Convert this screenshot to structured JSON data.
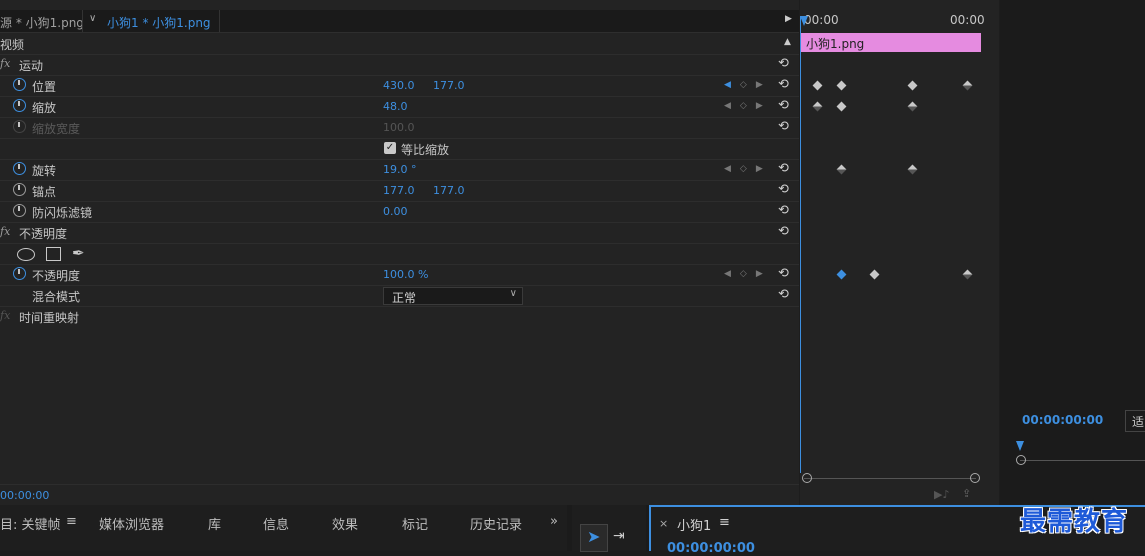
{
  "tabs": {
    "source": "源 * 小狗1.png",
    "active": "小狗1 * 小狗1.png"
  },
  "timeline": {
    "start": "00:00",
    "end": "00:00",
    "clip": "小狗1.png",
    "clip_color": "#e58be0"
  },
  "section": "视频",
  "motion": {
    "title": "运动",
    "position": {
      "label": "位置",
      "x": "430.0",
      "y": "177.0"
    },
    "scale": {
      "label": "缩放",
      "value": "48.0"
    },
    "scale_width": {
      "label": "缩放宽度",
      "value": "100.0"
    },
    "uniform": {
      "label": "等比缩放",
      "checked": true
    },
    "rotation": {
      "label": "旋转",
      "value": "19.0 °"
    },
    "anchor": {
      "label": "锚点",
      "x": "177.0",
      "y": "177.0"
    },
    "antiflicker": {
      "label": "防闪烁滤镜",
      "value": "0.00"
    }
  },
  "opacity": {
    "title": "不透明度",
    "value_label": "不透明度",
    "value": "100.0 %",
    "blend_label": "混合模式",
    "blend_value": "正常"
  },
  "time_remap": {
    "title": "时间重映射"
  },
  "current_time": "00:00:00",
  "monitor": {
    "time": "00:00:00:00",
    "fit": "适"
  },
  "bottom_tabs": [
    "目: 关键帧",
    "媒体浏览器",
    "库",
    "信息",
    "效果",
    "标记",
    "历史记录"
  ],
  "sequence": {
    "name": "小狗1",
    "time": "00:00:00:00"
  },
  "watermark": "最需教育",
  "accent": "#3d8fe0"
}
